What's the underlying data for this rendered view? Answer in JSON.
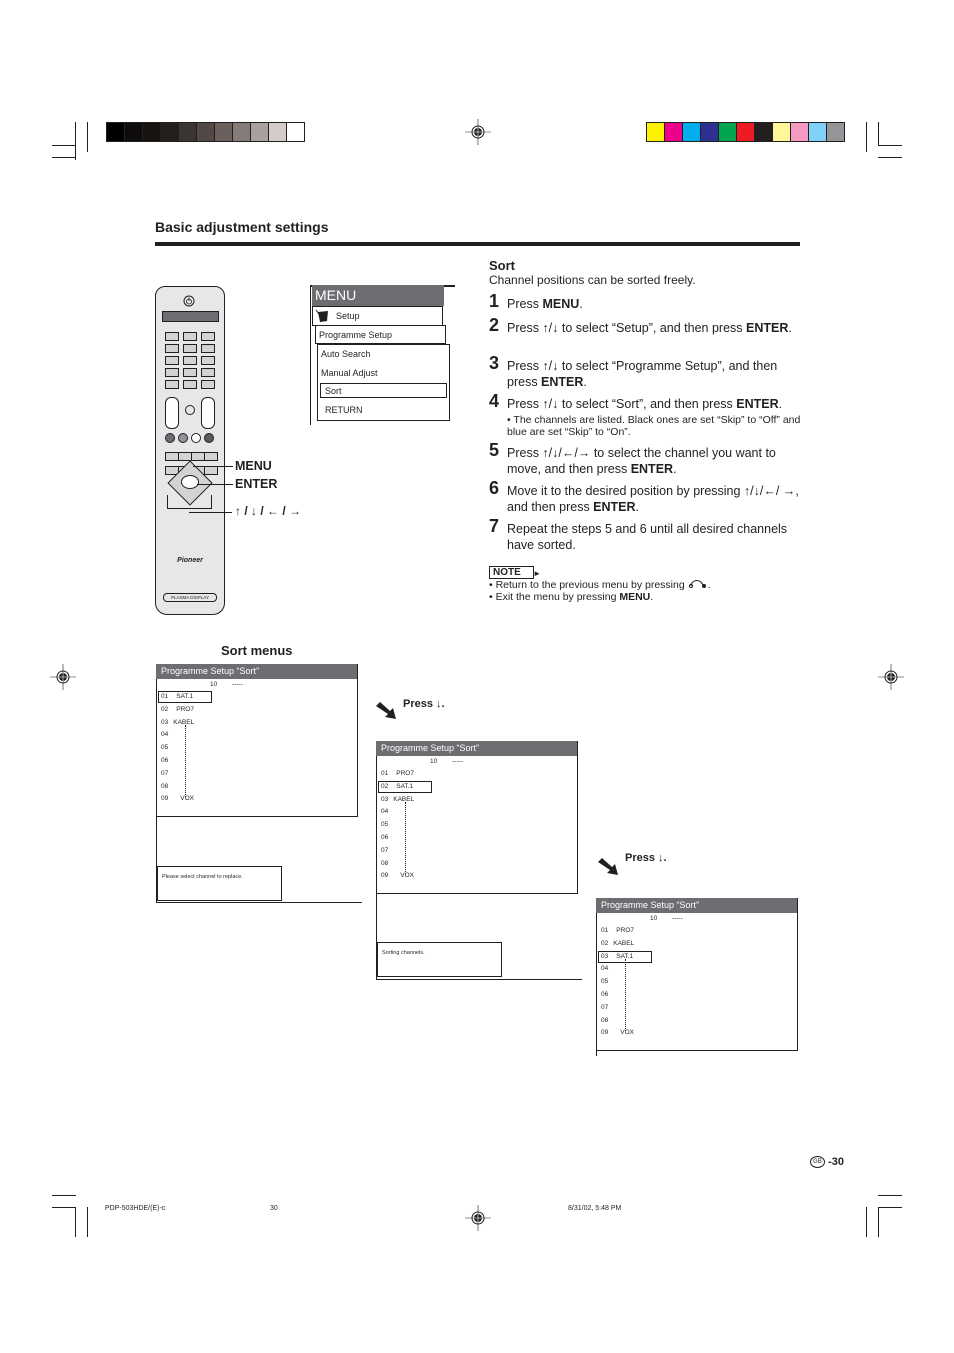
{
  "print_marks": {
    "grayscale_swatches": [
      "#000000",
      "#0e0c0b",
      "#161311",
      "#231f1c",
      "#3a3432",
      "#524845",
      "#6a5f5c",
      "#857b79",
      "#a8a09e",
      "#d4cccb",
      "#ffffff"
    ],
    "color_swatches": [
      "#fff200",
      "#ec008c",
      "#00aeef",
      "#2e3192",
      "#00a651",
      "#ed1c24",
      "#231f20",
      "#fff799",
      "#f49ac1",
      "#7fd3f7",
      "#939598"
    ]
  },
  "section_title": "Basic adjustment settings",
  "remote": {
    "brand": "Pioneer",
    "model_label": "PLASMA DISPLAY",
    "callouts": {
      "menu": "MENU",
      "enter": "ENTER",
      "arrows": "↑ / ↓ / ← / →"
    }
  },
  "menu_diagram": {
    "title": "MENU",
    "level1": "Setup",
    "level2": "Programme Setup",
    "level3_items": [
      "Auto Search",
      "Manual Adjust",
      "Sort",
      "RETURN"
    ],
    "selected": "Sort"
  },
  "sort_section": {
    "heading": "Sort",
    "subtitle": "Channel positions can be sorted freely.",
    "steps": [
      {
        "num": "1",
        "pre": "Press ",
        "bold": "MENU",
        "post": "."
      },
      {
        "num": "2",
        "pre": "Press ↑/↓ to select “Setup”, and then press ",
        "bold": "ENTER",
        "post": "."
      },
      {
        "num": "3",
        "pre": "Press ↑/↓ to select “Programme Setup”, and then press ",
        "bold": "ENTER",
        "post": "."
      },
      {
        "num": "4",
        "pre": "Press ↑/↓ to select “Sort”, and then press ",
        "bold": "ENTER",
        "post": "."
      },
      {
        "num": "5",
        "pre": "Press ↑/↓/←/→ to select the channel you want to move, and then press ",
        "bold": "ENTER",
        "post": "."
      },
      {
        "num": "6",
        "pre": "Move it to the desired position by pressing ↑/↓/←/ →, and then press ",
        "bold": "ENTER",
        "post": "."
      },
      {
        "num": "7",
        "pre": "Repeat the steps 5 and 6 until all desired channels have sorted.",
        "bold": "",
        "post": ""
      }
    ],
    "step4_bullet": "• The channels are listed.  Black ones are set “Skip” to “Off” and blue are set “Skip” to “On”.",
    "note_label": "NOTE",
    "notes": [
      {
        "pre": "• Return to the previous menu by pressing ",
        "icon": "return-icon",
        "bold": "",
        "post": "."
      },
      {
        "pre": "• Exit the menu by pressing ",
        "icon": "",
        "bold": "MENU",
        "post": "."
      }
    ]
  },
  "sort_menus": {
    "heading": "Sort menus",
    "press_label": "Press ↓.",
    "screens": [
      {
        "title": "Programme Setup “Sort”",
        "header_num": "10",
        "header_dash": "-----",
        "rows": [
          {
            "num": "01",
            "name": "SAT.1"
          },
          {
            "num": "02",
            "name": "PRO7"
          },
          {
            "num": "03",
            "name": "KABEL"
          },
          {
            "num": "04",
            "name": ""
          },
          {
            "num": "05",
            "name": ""
          },
          {
            "num": "06",
            "name": ""
          },
          {
            "num": "07",
            "name": ""
          },
          {
            "num": "08",
            "name": ""
          },
          {
            "num": "09",
            "name": "VOX"
          }
        ],
        "selected_index": 0,
        "message": "Please select channel to replace."
      },
      {
        "title": "Programme Setup “Sort”",
        "header_num": "10",
        "header_dash": "-----",
        "rows": [
          {
            "num": "01",
            "name": "PRO7"
          },
          {
            "num": "02",
            "name": "SAT.1"
          },
          {
            "num": "03",
            "name": "KABEL"
          },
          {
            "num": "04",
            "name": ""
          },
          {
            "num": "05",
            "name": ""
          },
          {
            "num": "06",
            "name": ""
          },
          {
            "num": "07",
            "name": ""
          },
          {
            "num": "08",
            "name": ""
          },
          {
            "num": "09",
            "name": "VOX"
          }
        ],
        "selected_index": 1,
        "message": "Sorting channels."
      },
      {
        "title": "Programme Setup “Sort”",
        "header_num": "10",
        "header_dash": "-----",
        "rows": [
          {
            "num": "01",
            "name": "PRO7"
          },
          {
            "num": "02",
            "name": "KABEL"
          },
          {
            "num": "03",
            "name": "SAT.1"
          },
          {
            "num": "04",
            "name": ""
          },
          {
            "num": "05",
            "name": ""
          },
          {
            "num": "06",
            "name": ""
          },
          {
            "num": "07",
            "name": ""
          },
          {
            "num": "08",
            "name": ""
          },
          {
            "num": "09",
            "name": "VOX"
          }
        ],
        "selected_index": 2,
        "message": ""
      }
    ]
  },
  "page_number": {
    "region": "GB",
    "number": "-30"
  },
  "footer": {
    "file": "PDP-503HDE/(E)-c",
    "page": "30",
    "timestamp": "8/31/02, 5:48 PM"
  }
}
